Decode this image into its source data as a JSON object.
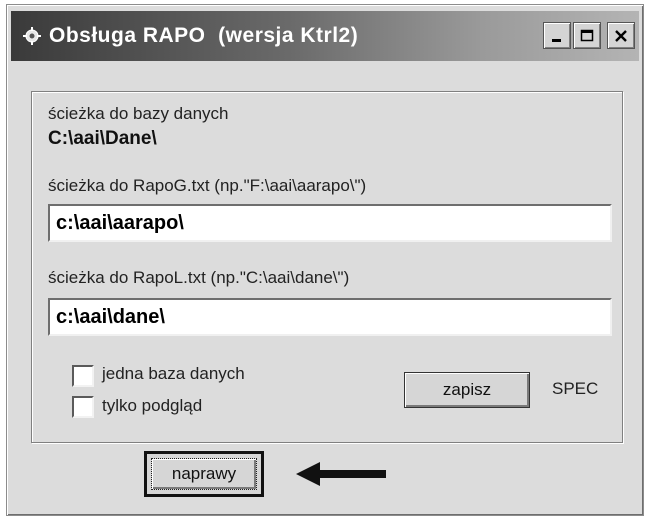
{
  "window": {
    "title": "Obsługa RAPO  (wersja Ktrl2)",
    "title_buttons": [
      "minimize",
      "maximize",
      "close"
    ]
  },
  "panel": {
    "db_path_label": "ścieżka do bazy danych",
    "db_path_value": "C:\\aai\\Dane\\",
    "rapog_label": "ścieżka do RapoG.txt  (np.\"F:\\aai\\aarapo\\\")",
    "rapog_value": "c:\\aai\\aarapo\\",
    "rapol_label": "ścieżka do RapoL.txt  (np.\"C:\\aai\\dane\\\")",
    "rapol_value": "c:\\aai\\dane\\",
    "checkbox_one_db": {
      "label": "jedna baza danych",
      "checked": false
    },
    "checkbox_preview": {
      "label": "tylko podgląd",
      "checked": false
    },
    "save_button": "zapisz",
    "spec_label": "SPEC"
  },
  "naprawy_button": "naprawy",
  "icons": {
    "app": "app-icon",
    "arrow": "left-arrow-icon"
  },
  "colors": {
    "titlebar_dark": "#3a3a3a",
    "face": "#dcdcdc"
  }
}
